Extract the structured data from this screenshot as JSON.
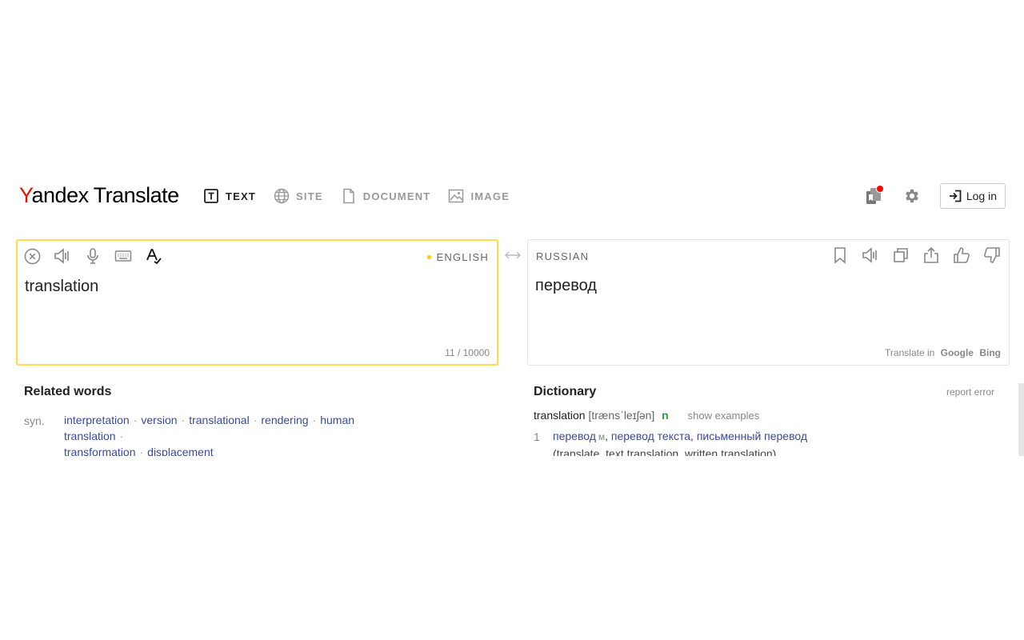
{
  "header": {
    "logo_y": "Y",
    "logo_brand": "andex",
    "logo_product": "Translate",
    "tabs": [
      {
        "label": "TEXT",
        "icon": "text-box-icon",
        "active": true
      },
      {
        "label": "SITE",
        "icon": "globe-icon",
        "active": false
      },
      {
        "label": "DOCUMENT",
        "icon": "document-icon",
        "active": false
      },
      {
        "label": "IMAGE",
        "icon": "image-icon",
        "active": false
      }
    ],
    "login_label": "Log in"
  },
  "source": {
    "language": "ENGLISH",
    "text": "translation",
    "counter": "11 / 10000"
  },
  "target": {
    "language": "RUSSIAN",
    "text": "перевод",
    "translate_in_label": "Translate in",
    "engines": [
      "Google",
      "Bing"
    ]
  },
  "related": {
    "title": "Related words",
    "syn_label": "syn.",
    "synonyms": [
      "interpretation",
      "version",
      "translational",
      "rendering",
      "human translation",
      "transformation",
      "displacement"
    ]
  },
  "dictionary": {
    "title": "Dictionary",
    "report": "report error",
    "word": "translation",
    "transcription": "[trænsˈleɪʃən]",
    "pos": "n",
    "show_examples": "show examples",
    "entries": [
      {
        "num": "1",
        "main": "перевод",
        "gender": "м",
        "alts": [
          "перевод текста",
          "письменный перевод"
        ],
        "gloss": "(translate, text translation, written translation)"
      }
    ]
  },
  "colors": {
    "accent_yellow": "#ffdb4d",
    "brand_red": "#e61400",
    "link_blue": "#3b4a9c",
    "pos_green": "#2a9d3c",
    "notification_red": "#ff0000"
  }
}
